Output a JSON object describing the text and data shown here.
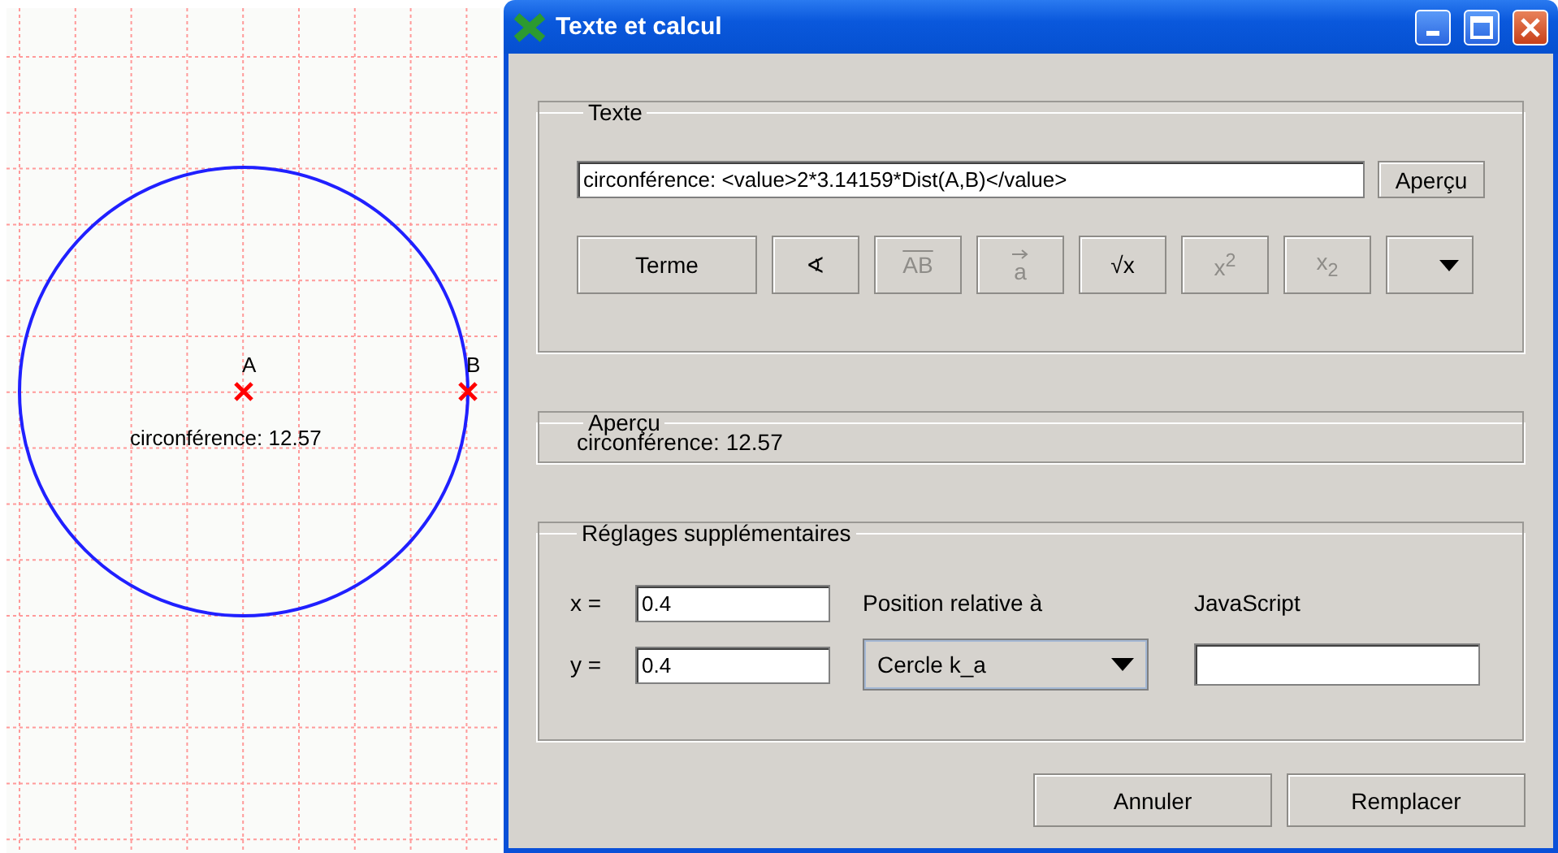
{
  "canvas": {
    "points": [
      {
        "label": "A"
      },
      {
        "label": "B"
      }
    ],
    "caption": "circonférence: 12.57"
  },
  "window": {
    "title": "Texte et calcul"
  },
  "texte": {
    "legend": "Texte",
    "value": "circonférence: <value>2*3.14159*Dist(A,B)</value>",
    "preview_button": "Aperçu",
    "tools": [
      {
        "kind": "text",
        "label": "Terme",
        "disabled": false
      },
      {
        "kind": "angle",
        "label": "∢",
        "disabled": false
      },
      {
        "kind": "overline",
        "label": "AB",
        "disabled": true
      },
      {
        "kind": "vector",
        "label": "a",
        "disabled": true
      },
      {
        "kind": "root",
        "label": "√x",
        "disabled": false
      },
      {
        "kind": "sup",
        "label": "x$^{2}$",
        "disabled": true
      },
      {
        "kind": "sub",
        "label": "x$_{2}$",
        "disabled": true
      },
      {
        "kind": "menu",
        "disabled": false
      }
    ]
  },
  "apercu": {
    "legend": "Aperçu",
    "text": "circonférence: 12.57"
  },
  "reglages": {
    "legend": "Réglages supplémentaires",
    "x_label": "x =",
    "x_value": "0.4",
    "y_label": "y =",
    "y_value": "0.4",
    "relative_label": "Position relative à",
    "relative_value": "Cercle k_a",
    "javascript_label": "JavaScript"
  },
  "buttons": [
    "Annuler",
    "Remplacer"
  ]
}
